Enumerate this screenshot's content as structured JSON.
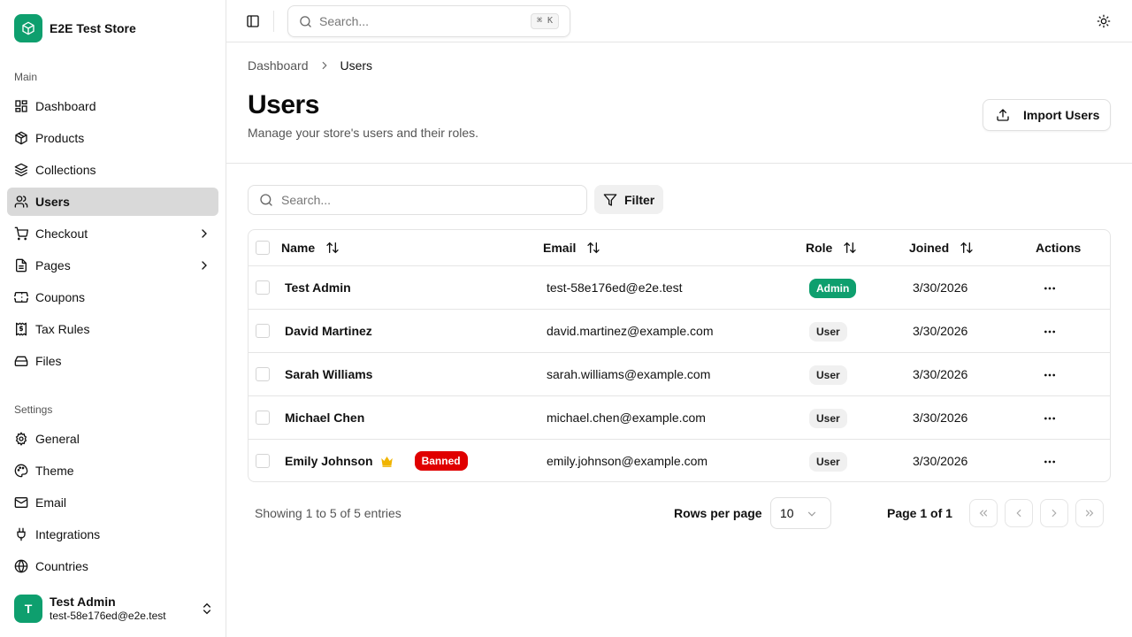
{
  "app": {
    "store_name": "E2E Test Store"
  },
  "sidebar": {
    "main_label": "Main",
    "main_items": [
      {
        "label": "Dashboard",
        "icon": "dashboard-icon"
      },
      {
        "label": "Products",
        "icon": "package-icon"
      },
      {
        "label": "Collections",
        "icon": "layers-icon"
      },
      {
        "label": "Users",
        "icon": "users-icon",
        "active": true
      },
      {
        "label": "Checkout",
        "icon": "cart-icon",
        "has_submenu": true
      },
      {
        "label": "Pages",
        "icon": "file-icon",
        "has_submenu": true
      },
      {
        "label": "Coupons",
        "icon": "ticket-icon"
      },
      {
        "label": "Tax Rules",
        "icon": "receipt-icon"
      },
      {
        "label": "Files",
        "icon": "drive-icon"
      }
    ],
    "settings_label": "Settings",
    "settings_items": [
      {
        "label": "General",
        "icon": "gear-icon"
      },
      {
        "label": "Theme",
        "icon": "palette-icon"
      },
      {
        "label": "Email",
        "icon": "mail-icon"
      },
      {
        "label": "Integrations",
        "icon": "plug-icon"
      },
      {
        "label": "Countries",
        "icon": "globe-icon"
      }
    ],
    "user": {
      "initial": "T",
      "name": "Test Admin",
      "email": "test-58e176ed@e2e.test"
    }
  },
  "topbar": {
    "search_placeholder": "Search...",
    "shortcut": "⌘ K"
  },
  "breadcrumb": {
    "parent": "Dashboard",
    "current": "Users"
  },
  "page": {
    "title": "Users",
    "subtitle": "Manage your store's users and their roles.",
    "import_label": "Import Users"
  },
  "toolbar": {
    "search_placeholder": "Search...",
    "filter_label": "Filter"
  },
  "table": {
    "columns": {
      "name": "Name",
      "email": "Email",
      "role": "Role",
      "joined": "Joined",
      "actions": "Actions"
    },
    "rows": [
      {
        "name": "Test Admin",
        "email": "test-58e176ed@e2e.test",
        "role": "Admin",
        "joined": "3/30/2026"
      },
      {
        "name": "David Martinez",
        "email": "david.martinez@example.com",
        "role": "User",
        "joined": "3/30/2026"
      },
      {
        "name": "Sarah Williams",
        "email": "sarah.williams@example.com",
        "role": "User",
        "joined": "3/30/2026"
      },
      {
        "name": "Michael Chen",
        "email": "michael.chen@example.com",
        "role": "User",
        "joined": "3/30/2026"
      },
      {
        "name": "Emily Johnson",
        "email": "emily.johnson@example.com",
        "role": "User",
        "joined": "3/30/2026",
        "crown": true,
        "status_badge": "Banned"
      }
    ]
  },
  "pagination": {
    "showing": "Showing 1 to 5 of 5 entries",
    "rows_per_page_label": "Rows per page",
    "rows_per_page_value": "10",
    "page_info": "Page 1 of 1"
  },
  "colors": {
    "brand": "#0e9f6e",
    "banned": "#e00000",
    "crown": "#f0b400",
    "active_nav": "#d9d9d9"
  }
}
